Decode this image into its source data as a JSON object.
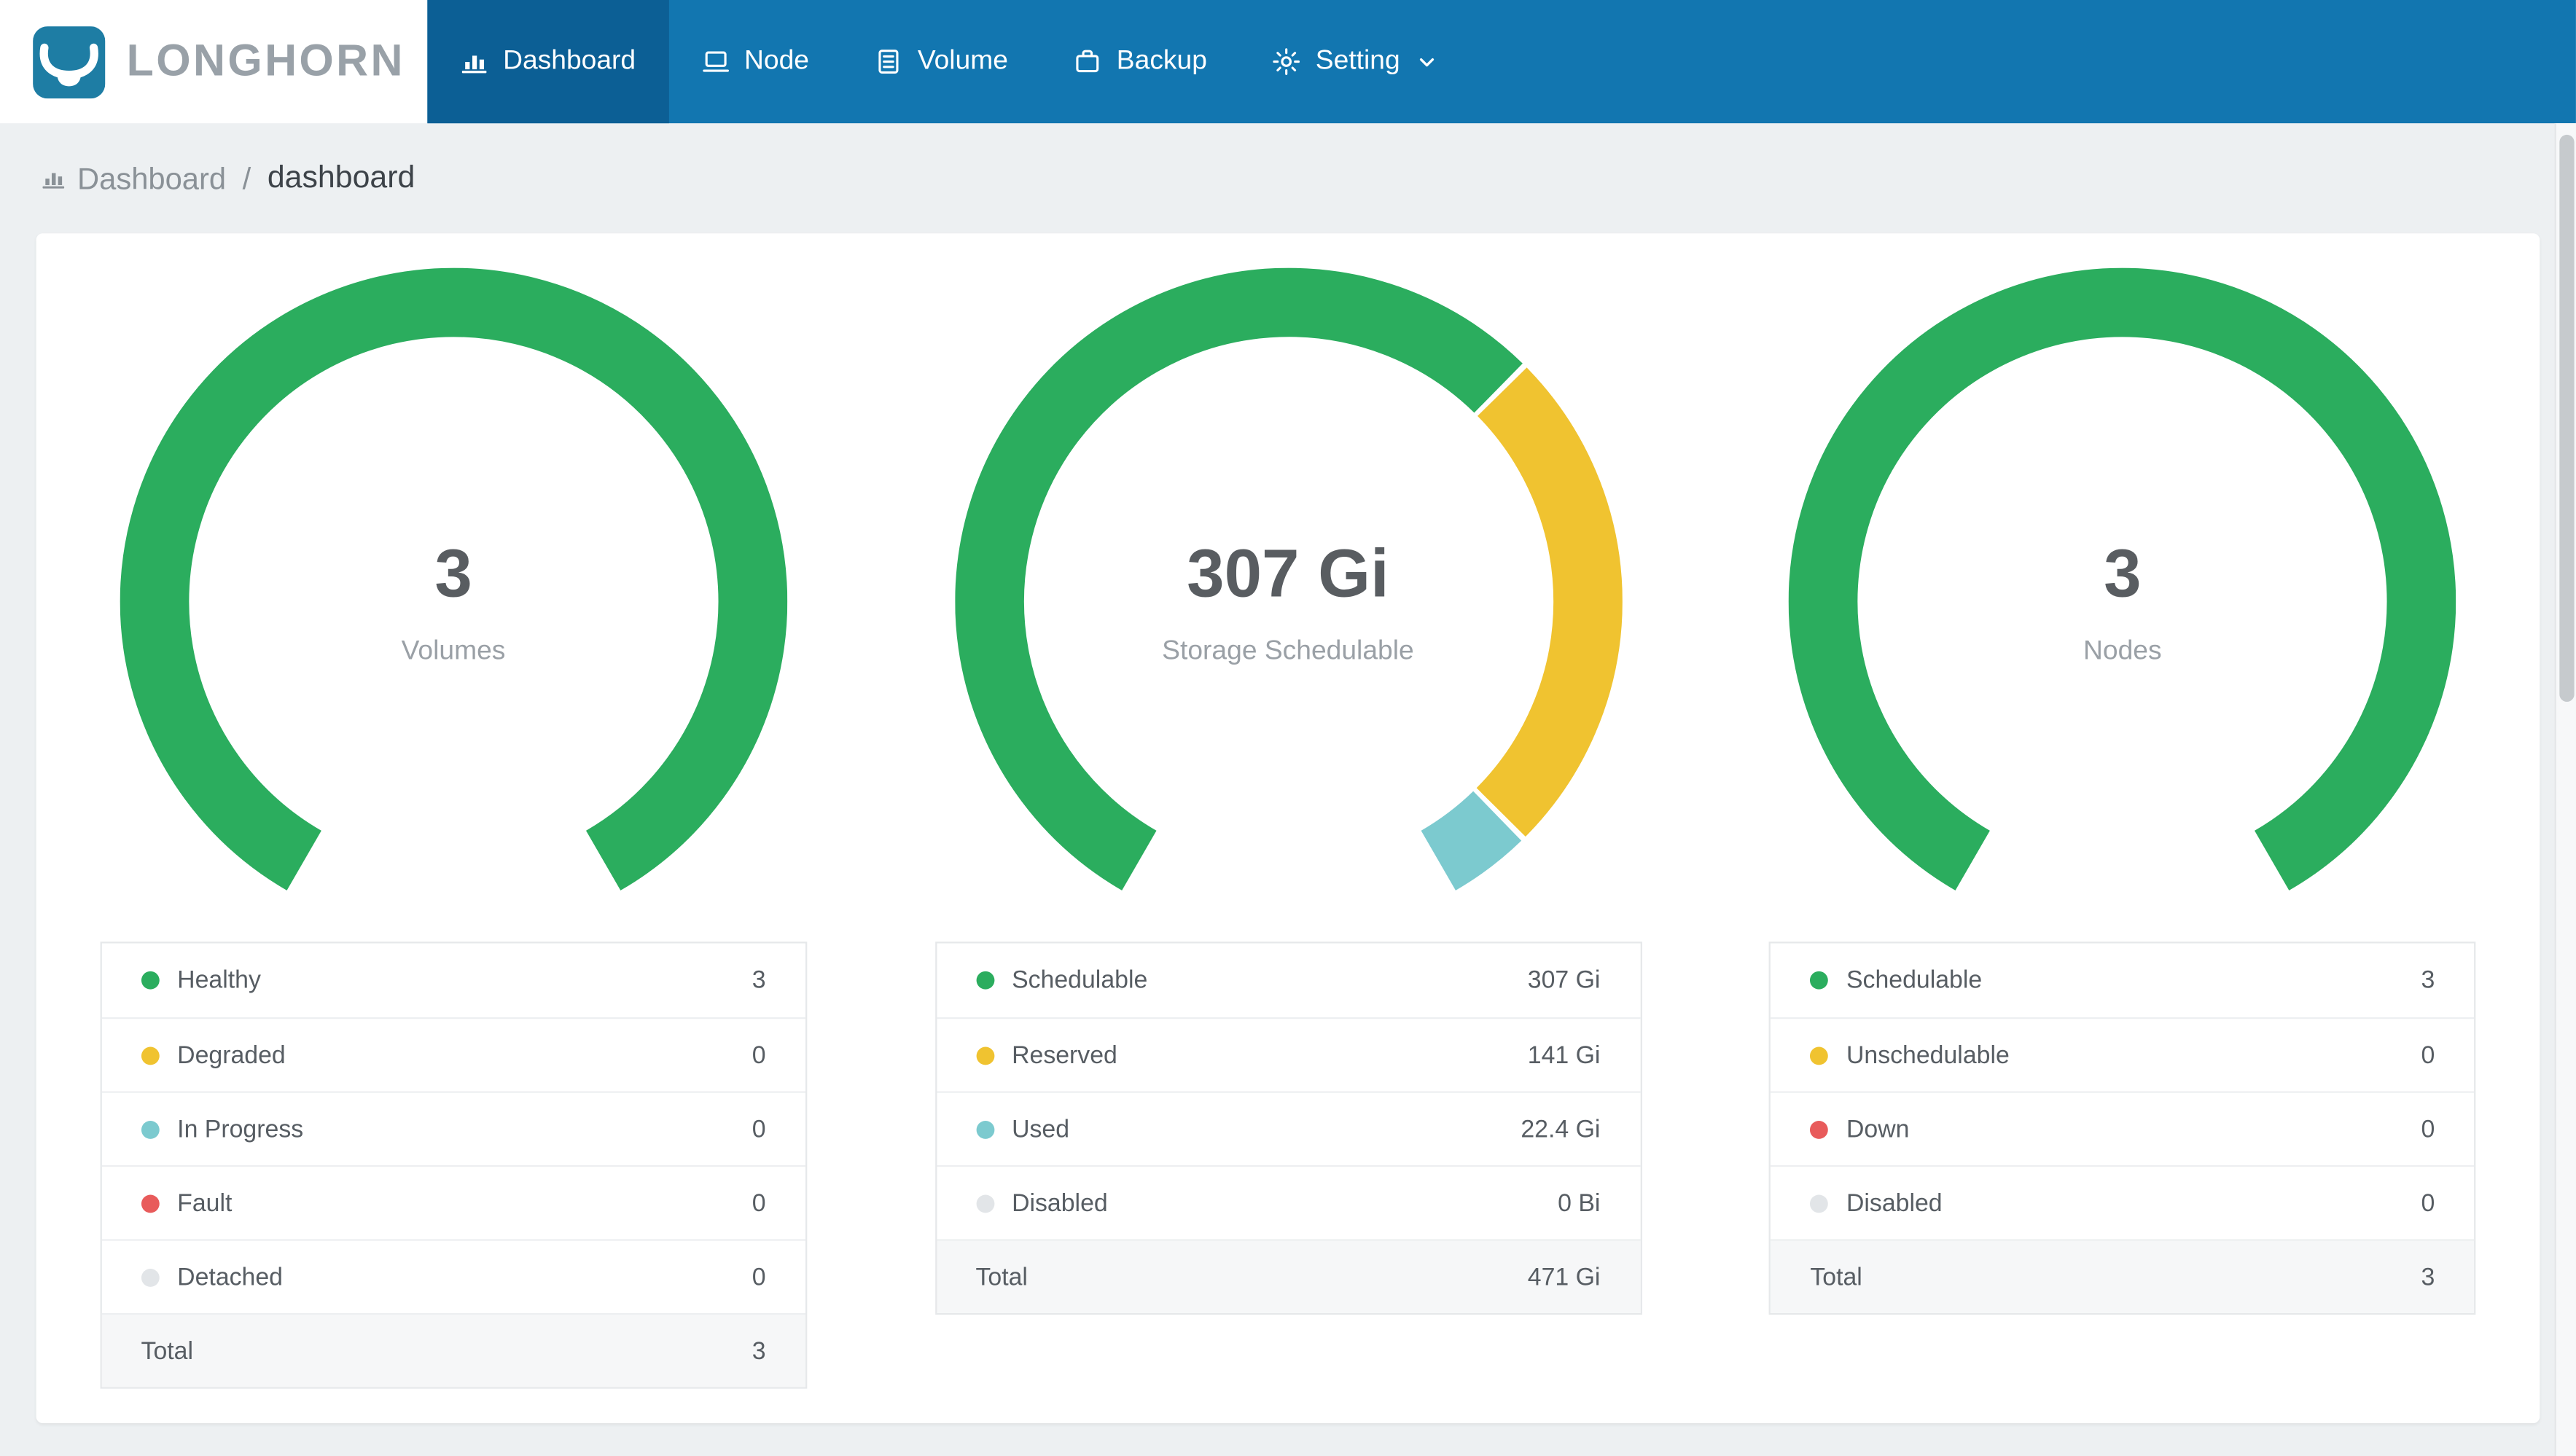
{
  "app": {
    "name": "LONGHORN"
  },
  "colors": {
    "brand_blue": "#1276B0",
    "brand_blue_active": "#0C5F95",
    "logo_teal": "#1E7DA4",
    "status_green": "#2BAD5E",
    "status_yellow": "#F0C330",
    "status_teal": "#7CCACF",
    "status_red": "#E85B5B",
    "status_gray": "#E2E5E8"
  },
  "nav": {
    "items": [
      {
        "label": "Dashboard",
        "icon": "bar-chart-icon",
        "active": true,
        "has_dropdown": false
      },
      {
        "label": "Node",
        "icon": "node-icon",
        "active": false,
        "has_dropdown": false
      },
      {
        "label": "Volume",
        "icon": "volume-icon",
        "active": false,
        "has_dropdown": false
      },
      {
        "label": "Backup",
        "icon": "backup-icon",
        "active": false,
        "has_dropdown": false
      },
      {
        "label": "Setting",
        "icon": "gear-icon",
        "active": false,
        "has_dropdown": true
      }
    ]
  },
  "breadcrumb": {
    "root": "Dashboard",
    "separator": "/",
    "current": "dashboard"
  },
  "chart_data": [
    {
      "type": "donut-gauge",
      "center_value": "3",
      "center_label": "Volumes",
      "arc": {
        "start_deg": 210,
        "sweep_deg": 300,
        "thickness": 42
      },
      "rows": [
        {
          "label": "Healthy",
          "value": 3,
          "display": "3",
          "color": "#2BAD5E"
        },
        {
          "label": "Degraded",
          "value": 0,
          "display": "0",
          "color": "#F0C330"
        },
        {
          "label": "In Progress",
          "value": 0,
          "display": "0",
          "color": "#7CCACF"
        },
        {
          "label": "Fault",
          "value": 0,
          "display": "0",
          "color": "#E85B5B"
        },
        {
          "label": "Detached",
          "value": 0,
          "display": "0",
          "color": "#E2E5E8"
        }
      ],
      "total": {
        "label": "Total",
        "display": "3"
      }
    },
    {
      "type": "donut-gauge",
      "center_value": "307 Gi",
      "center_label": "Storage Schedulable",
      "arc": {
        "start_deg": 210,
        "sweep_deg": 300,
        "thickness": 42
      },
      "rows": [
        {
          "label": "Schedulable",
          "value": 307,
          "display": "307 Gi",
          "color": "#2BAD5E"
        },
        {
          "label": "Reserved",
          "value": 141,
          "display": "141 Gi",
          "color": "#F0C330"
        },
        {
          "label": "Used",
          "value": 22.4,
          "display": "22.4 Gi",
          "color": "#7CCACF"
        },
        {
          "label": "Disabled",
          "value": 0,
          "display": "0 Bi",
          "color": "#E2E5E8"
        }
      ],
      "total": {
        "label": "Total",
        "display": "471 Gi"
      }
    },
    {
      "type": "donut-gauge",
      "center_value": "3",
      "center_label": "Nodes",
      "arc": {
        "start_deg": 210,
        "sweep_deg": 300,
        "thickness": 42
      },
      "rows": [
        {
          "label": "Schedulable",
          "value": 3,
          "display": "3",
          "color": "#2BAD5E"
        },
        {
          "label": "Unschedulable",
          "value": 0,
          "display": "0",
          "color": "#F0C330"
        },
        {
          "label": "Down",
          "value": 0,
          "display": "0",
          "color": "#E85B5B"
        },
        {
          "label": "Disabled",
          "value": 0,
          "display": "0",
          "color": "#E2E5E8"
        }
      ],
      "total": {
        "label": "Total",
        "display": "3"
      }
    }
  ]
}
